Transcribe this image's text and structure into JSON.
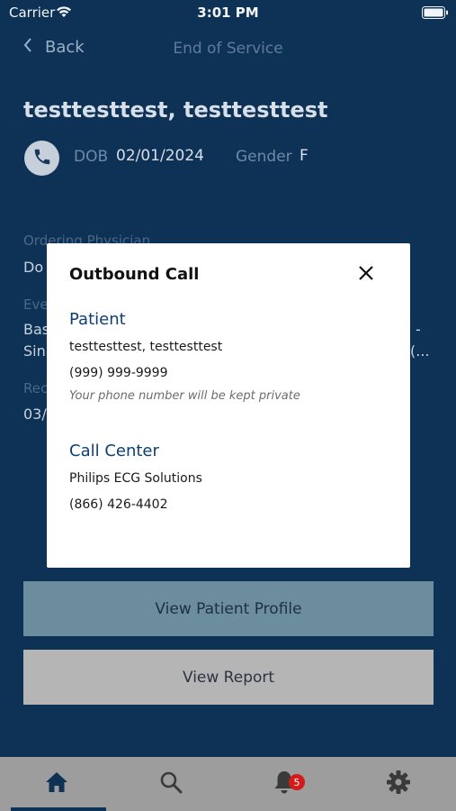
{
  "status_bar": {
    "carrier": "Carrier",
    "time": "3:01 PM"
  },
  "nav": {
    "back_label": "Back",
    "title": "End of Service"
  },
  "patient": {
    "name": "testtesttest, testtesttest",
    "dob_label": "DOB",
    "dob": "02/01/2024",
    "gender_label": "Gender",
    "gender": "F"
  },
  "background_details": {
    "ordering_physician_label": "Ordering Physician",
    "ordering_physician_value": "Do",
    "event_label": "Eve",
    "event_value_line1": "Bas",
    "event_value_line1_end": "-",
    "event_value_line2": "Sin",
    "event_value_line2_end": "(...",
    "received_label": "Rec",
    "received_value": "03/"
  },
  "modal": {
    "title": "Outbound Call",
    "patient_section": {
      "title": "Patient",
      "name": "testtesttest, testtesttest",
      "phone": "(999) 999-9999",
      "note": "Your phone number will be kept private"
    },
    "call_center_section": {
      "title": "Call Center",
      "name": "Philips ECG Solutions",
      "phone": "(866) 426-4402"
    }
  },
  "buttons": {
    "view_patient_profile": "View Patient Profile",
    "view_report": "View Report"
  },
  "tab_bar": {
    "alerts_badge": "5",
    "active_tab": "home"
  },
  "colors": {
    "background": "#0e3156",
    "modal_section_title": "#0e3f73",
    "badge": "#d51a1a"
  }
}
